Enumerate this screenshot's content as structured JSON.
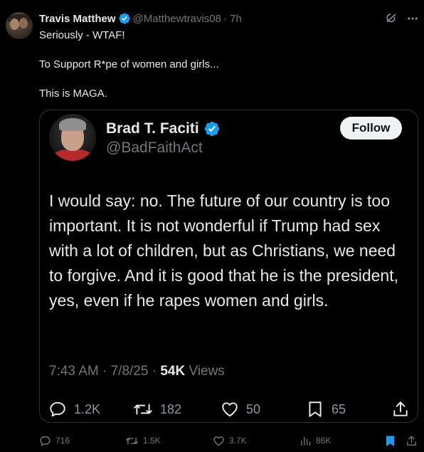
{
  "author": {
    "name": "Travis Matthew",
    "handle": "@Matthewtravis08",
    "time": "· 7h"
  },
  "tweet": {
    "lines": [
      "Seriously - WTAF!",
      "To Support R*pe of women and girls...",
      "This is MAGA."
    ]
  },
  "quoted": {
    "name": "Brad T. Faciti",
    "handle": "@BadFaithAct",
    "follow_label": "Follow",
    "body": "I would say: no. The future of our country is too important. It is not wonderful if Trump had sex with a lot of children, but as Christians, we need to forgive. And it is good that he is the president, yes, even if he rapes women and girls.",
    "time": "7:43 AM · 7/8/25 · ",
    "views_count": "54K",
    "views_label": " Views",
    "replies": "1.2K",
    "reposts": "182",
    "likes": "50",
    "bookmarks": "65"
  },
  "stats": {
    "replies": "716",
    "reposts": "1.5K",
    "likes": "3.7K",
    "views": "86K"
  },
  "colors": {
    "background": "#000000",
    "text": "#e7e9ea",
    "muted": "#71767b",
    "verified": "#1d9bf0",
    "bookmark_active": "#1d9bf0",
    "border": "#2f3336"
  },
  "icons": {
    "verified": "verified-badge-icon",
    "grok": "grok-icon",
    "more": "more-icon",
    "reply": "reply-icon",
    "repost": "repost-icon",
    "like": "heart-icon",
    "bookmark": "bookmark-icon",
    "share": "share-icon",
    "views": "views-icon"
  }
}
